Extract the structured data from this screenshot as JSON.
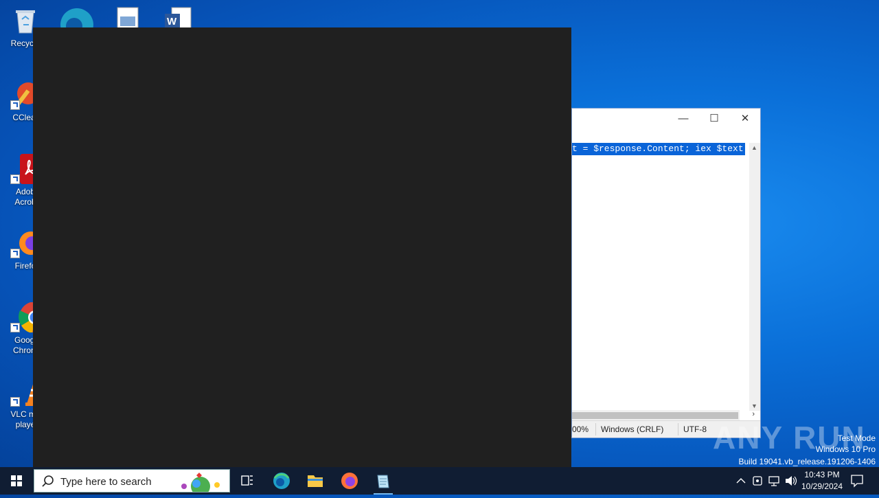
{
  "desktop": {
    "icons": [
      {
        "label": "Recycle",
        "icon": "recycle-bin-icon"
      },
      {
        "label": "CClear",
        "icon": "ccleaner-icon"
      },
      {
        "label_line1": "Adob",
        "label_line2": "Acrob",
        "icon": "adobe-acrobat-icon"
      },
      {
        "label": "Firefo",
        "icon": "firefox-icon"
      },
      {
        "label_line1": "Googl",
        "label_line2": "Chrom",
        "icon": "chrome-icon"
      },
      {
        "label_line1": "VLC me",
        "label_line2": "playe",
        "icon": "vlc-icon"
      }
    ],
    "top_icons": [
      "edge-icon",
      "image-file-icon",
      "word-document-icon"
    ]
  },
  "notepad": {
    "selected_text": "t = $response.Content; iex $text",
    "status": {
      "zoom": "00%",
      "line_endings": "Windows (CRLF)",
      "encoding": "UTF-8"
    },
    "controls": {
      "minimize": "—",
      "maximize": "☐",
      "close": "✕"
    }
  },
  "watermark": {
    "brand": "ANY RUN",
    "test_mode": "Test Mode",
    "edition": "Windows 10 Pro",
    "build": "Build 19041.vb_release.191206-1406"
  },
  "taskbar": {
    "search_placeholder": "Type here to search",
    "apps": [
      "task-view-icon",
      "edge-icon",
      "file-explorer-icon",
      "firefox-icon",
      "notepad-icon"
    ],
    "clock": {
      "time": "10:43 PM",
      "date": "10/29/2024"
    }
  }
}
